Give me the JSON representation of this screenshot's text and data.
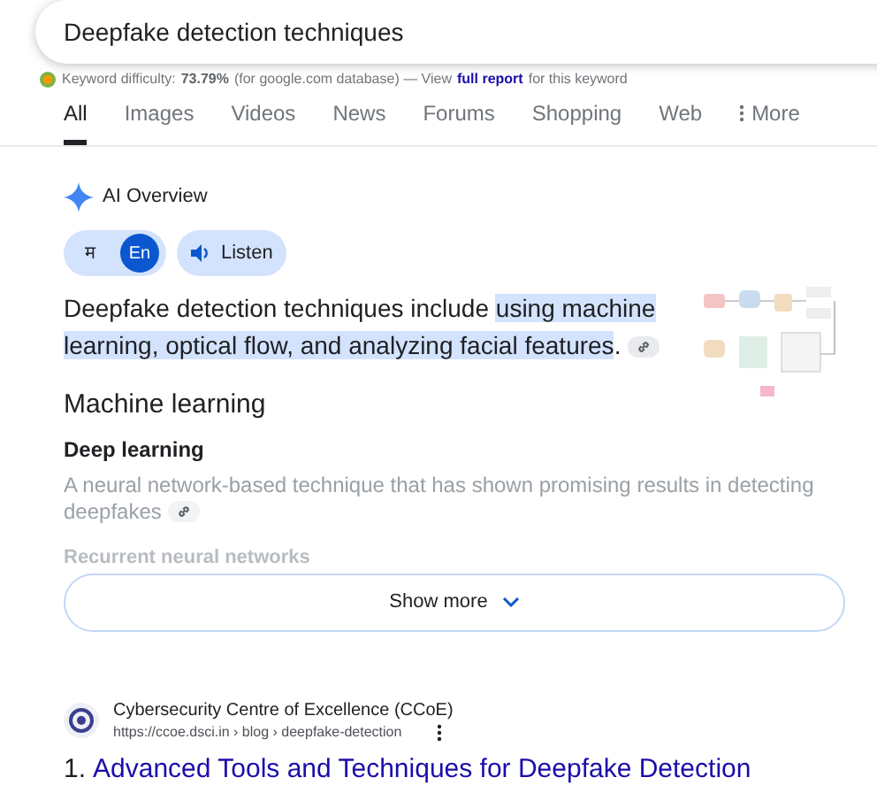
{
  "search": {
    "value": "Deepfake detection techniques"
  },
  "keyword_bar": {
    "label": "Keyword difficulty:",
    "value": "73.79%",
    "note": "(for google.com database) — View",
    "link": "full report",
    "suffix": "for this keyword"
  },
  "tabs": [
    {
      "label": "All",
      "selected": true
    },
    {
      "label": "Images",
      "selected": false
    },
    {
      "label": "Videos",
      "selected": false
    },
    {
      "label": "News",
      "selected": false
    },
    {
      "label": "Forums",
      "selected": false
    },
    {
      "label": "Shopping",
      "selected": false
    },
    {
      "label": "Web",
      "selected": false
    },
    {
      "label": "More",
      "selected": false,
      "kind": "menu"
    }
  ],
  "ai_overview": {
    "title": "AI Overview",
    "languages": [
      {
        "label": "म",
        "selected": false
      },
      {
        "label": "En",
        "selected": true
      }
    ],
    "listen": "Listen",
    "summary": {
      "text": "Deepfake detection techniques include",
      "highlight": "using machine learning, optical flow, and analyzing facial features",
      "end": "."
    },
    "heading": "Machine learning",
    "items": [
      {
        "title": "Deep learning",
        "text": "A neural network-based technique that has shown promising results in detecting deepfakes"
      }
    ],
    "faded_title": "Recurrent neural networks",
    "show_more": "Show more"
  },
  "result": {
    "site": "Cybersecurity Centre of Excellence (CCoE)",
    "url": "https://ccoe.dsci.in › blog › deepfake-detection",
    "number": "1.",
    "title": "Advanced Tools and Techniques for Deepfake Detection"
  }
}
